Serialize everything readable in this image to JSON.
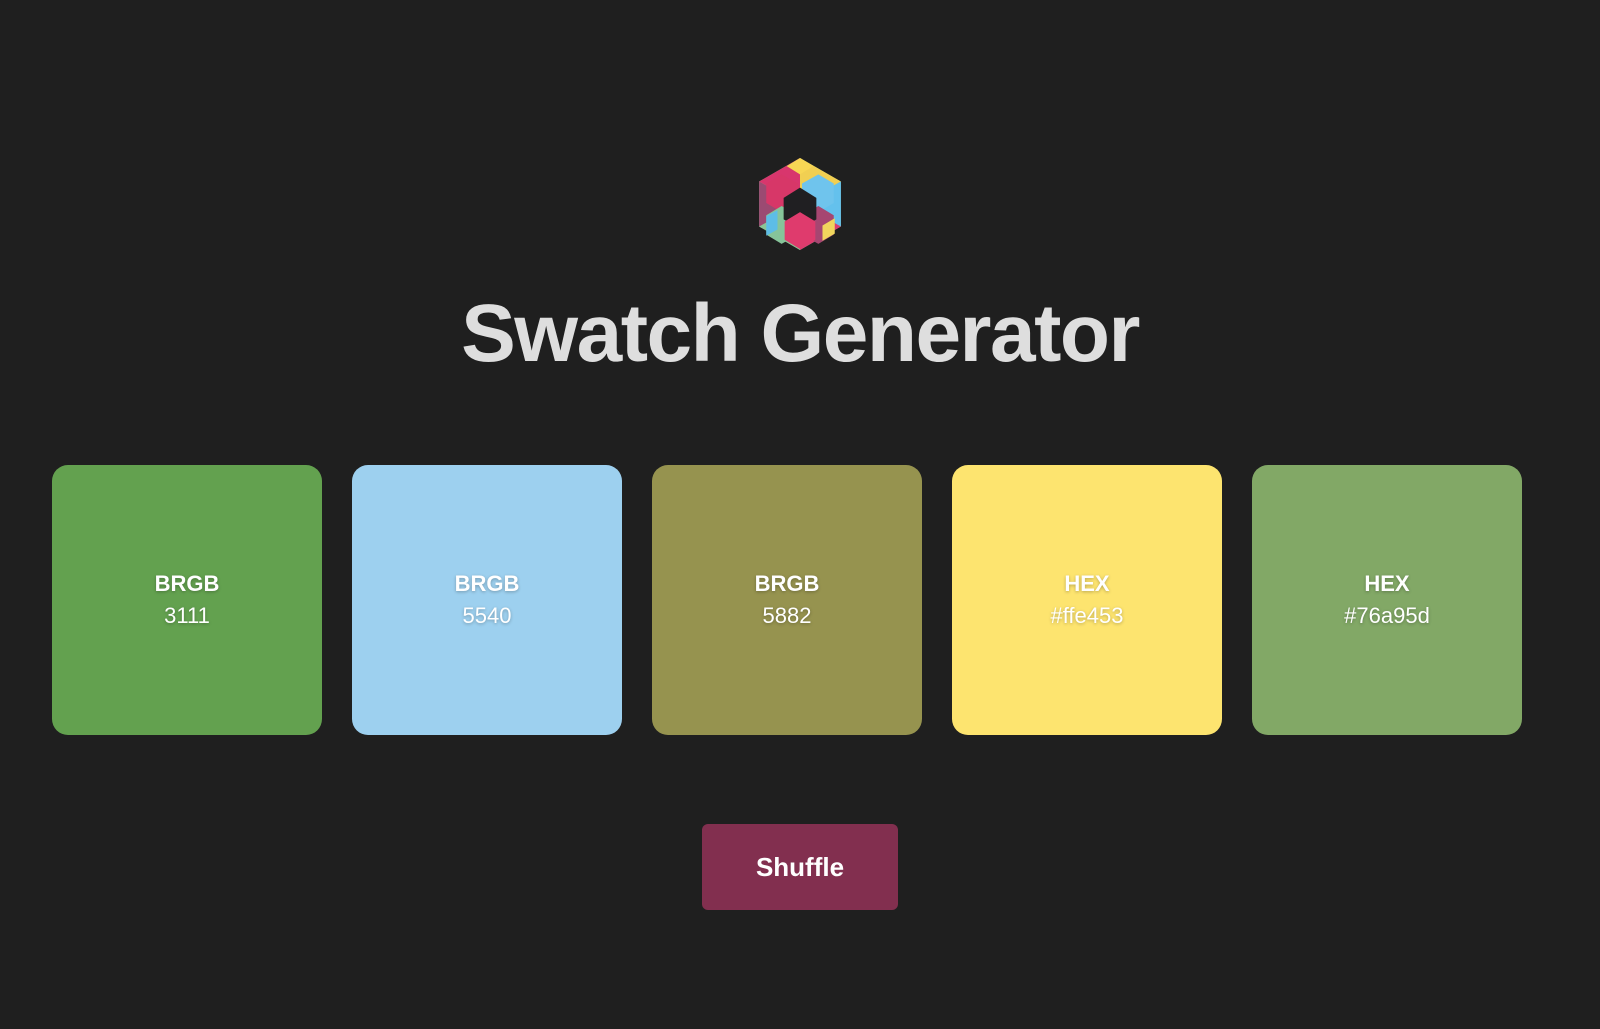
{
  "app": {
    "title": "Swatch Generator",
    "logo_icon": "hexagon-cube-logo-icon"
  },
  "swatches": [
    {
      "format": "BRGB",
      "value": "3111",
      "color": "#63a14f"
    },
    {
      "format": "BRGB",
      "value": "5540",
      "color": "#9dd0ef"
    },
    {
      "format": "BRGB",
      "value": "5882",
      "color": "#96934f"
    },
    {
      "format": "HEX",
      "value": "#ffe453",
      "color": "#fde46f"
    },
    {
      "format": "HEX",
      "value": "#76a95d",
      "color": "#82a866"
    }
  ],
  "shuffle": {
    "label": "Shuffle",
    "color": "#822f4f"
  }
}
